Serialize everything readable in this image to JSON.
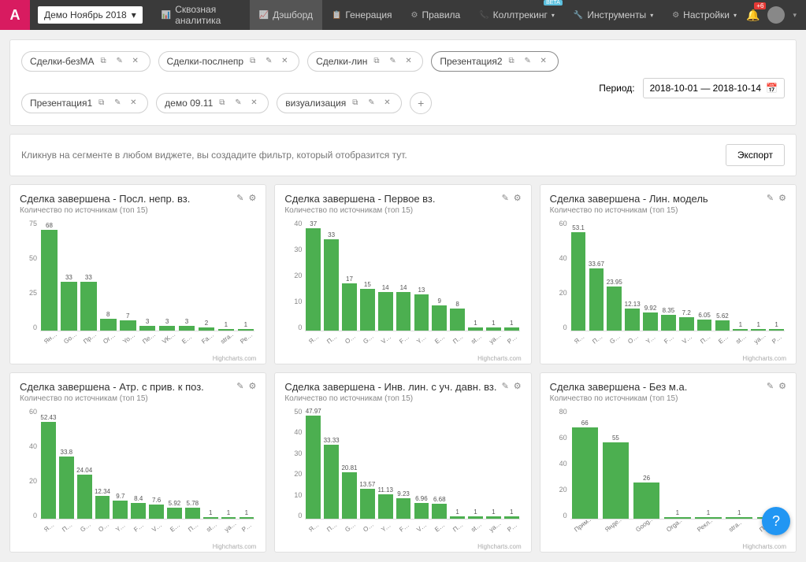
{
  "logo": "A",
  "subscription": "Демо Ноябрь 2018",
  "nav": [
    {
      "label": "Сквозная аналитика"
    },
    {
      "label": "Дэшборд",
      "active": true
    },
    {
      "label": "Генерация"
    },
    {
      "label": "Правила"
    },
    {
      "label": "Коллтрекинг",
      "badge": "BETA",
      "caret": true
    },
    {
      "label": "Инструменты",
      "caret": true
    },
    {
      "label": "Настройки",
      "caret": true
    }
  ],
  "bell_badge": "+6",
  "tabs": [
    {
      "label": "Сделки-безМА"
    },
    {
      "label": "Сделки-послнепр"
    },
    {
      "label": "Сделки-лин"
    },
    {
      "label": "Презентация2",
      "active": true
    },
    {
      "label": "Презентация1"
    },
    {
      "label": "демо 09.11"
    },
    {
      "label": "визуализация"
    }
  ],
  "period_label": "Период:",
  "period_value": "2018-10-01 — 2018-10-14",
  "filter_hint": "Кликнув на сегменте в любом виджете, вы создадите фильтр, который отобразится тут.",
  "export_label": "Экспорт",
  "credits": "Highcharts.com",
  "widgets": [
    {
      "title": "Сделка завершена - Посл. непр. вз.",
      "subtitle": "Количество по источникам (топ 15)"
    },
    {
      "title": "Сделка завершена - Первое вз.",
      "subtitle": "Количество по источникам (топ 15)"
    },
    {
      "title": "Сделка завершена - Лин. модель",
      "subtitle": "Количество по источникам (топ 15)"
    },
    {
      "title": "Сделка завершена - Атр. с прив. к поз.",
      "subtitle": "Количество по источникам (топ 15)"
    },
    {
      "title": "Сделка завершена - Инв. лин. с уч. давн. вз.",
      "subtitle": "Количество по источникам (топ 15)"
    },
    {
      "title": "Сделка завершена - Без м.а.",
      "subtitle": "Количество по источникам (топ 15)"
    }
  ],
  "chart_data": [
    {
      "type": "bar",
      "title": "Сделка завершена - Посл. непр. вз.",
      "ylim": [
        0,
        75
      ],
      "ticks": [
        0,
        25,
        50,
        75
      ],
      "categories": [
        "Янде..",
        "Goog..",
        "Прям..",
        "Orga..",
        "Yout..",
        "Пере..",
        "VKon..",
        "Emai..",
        "Face..",
        "stra..",
        "Рекл.."
      ],
      "values": [
        68,
        33,
        33,
        8,
        7,
        3,
        3,
        3,
        2,
        1,
        1
      ]
    },
    {
      "type": "bar",
      "title": "Сделка завершена - Первое вз.",
      "ylim": [
        0,
        40
      ],
      "ticks": [
        0,
        10,
        20,
        30,
        40
      ],
      "categories": [
        "Янде..",
        "Прям..",
        "Orga..",
        "Goog..",
        "VKon..",
        "Face..",
        "Yout..",
        "Emai..",
        "Пере..",
        "stra..",
        "yand..",
        "Рекл.."
      ],
      "values": [
        37,
        33,
        17,
        15,
        14,
        14,
        13,
        9,
        8,
        1,
        1,
        1
      ]
    },
    {
      "type": "bar",
      "title": "Сделка завершена - Лин. модель",
      "ylim": [
        0,
        60
      ],
      "ticks": [
        0,
        20,
        40,
        60
      ],
      "categories": [
        "Янде..",
        "Прям..",
        "Goog..",
        "Orga..",
        "Yout..",
        "Face..",
        "VKon..",
        "Пере..",
        "Emai..",
        "stra..",
        "yand..",
        "Рекл.."
      ],
      "values": [
        53.1,
        33.67,
        23.95,
        12.13,
        9.92,
        8.35,
        7.2,
        6.05,
        5.62,
        1,
        1,
        1
      ]
    },
    {
      "type": "bar",
      "title": "Сделка завершена - Атр. с прив. к поз.",
      "ylim": [
        0,
        60
      ],
      "ticks": [
        0,
        20,
        40,
        60
      ],
      "categories": [
        "Янде..",
        "Прям..",
        "Goog..",
        "Orga..",
        "Yout..",
        "Face..",
        "VKon..",
        "Emai..",
        "Пере..",
        "stra..",
        "yand..",
        "Рекл.."
      ],
      "values": [
        52.43,
        33.8,
        24.04,
        12.34,
        9.7,
        8.4,
        7.6,
        5.92,
        5.78,
        1,
        1,
        1
      ]
    },
    {
      "type": "bar",
      "title": "Сделка завершена - Инв. лин. с уч. давн. вз.",
      "ylim": [
        0,
        50
      ],
      "ticks": [
        0,
        10,
        20,
        30,
        40,
        50
      ],
      "categories": [
        "Янде..",
        "Прям..",
        "Goog..",
        "Orga..",
        "Yout..",
        "Face..",
        "VKon..",
        "Emai..",
        "Пере..",
        "stra..",
        "yand..",
        "Рекл.."
      ],
      "values": [
        47.97,
        33.33,
        20.81,
        13.57,
        11.13,
        9.23,
        6.96,
        6.68,
        1,
        1,
        1,
        1
      ]
    },
    {
      "type": "bar",
      "title": "Сделка завершена - Без м.а.",
      "ylim": [
        0,
        80
      ],
      "ticks": [
        0,
        20,
        40,
        60,
        80
      ],
      "categories": [
        "Прям..",
        "Янде..",
        "Goog..",
        "Orga..",
        "Рекл..",
        "stra..",
        "Пере.."
      ],
      "values": [
        66,
        55,
        26,
        1,
        1,
        1,
        1
      ]
    }
  ]
}
